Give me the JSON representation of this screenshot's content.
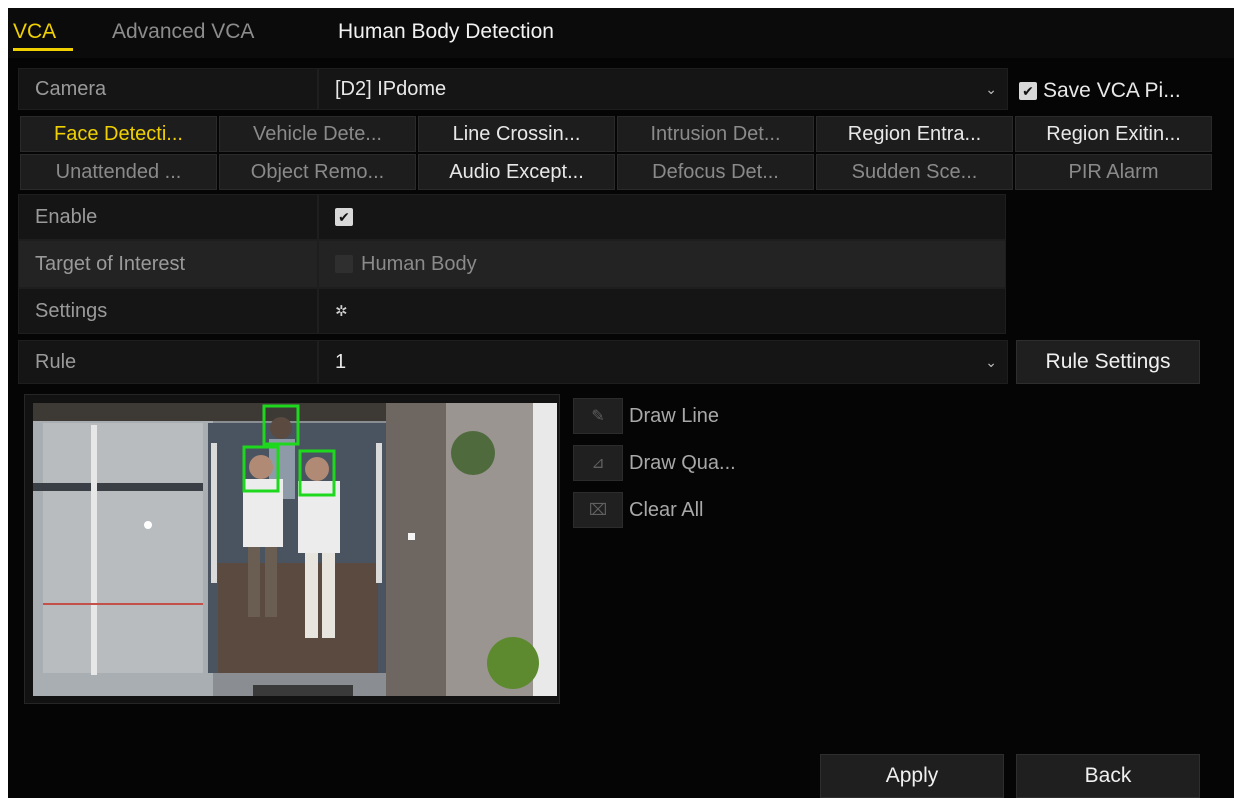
{
  "tabs": [
    {
      "label": "VCA"
    },
    {
      "label": "Advanced VCA"
    },
    {
      "label": "Human Body Detection"
    }
  ],
  "camera": {
    "label": "Camera",
    "value": "[D2] IPdome",
    "save_label": "Save VCA Pi...",
    "save_checked": true
  },
  "functions": {
    "row1": [
      "Face Detecti...",
      "Vehicle Dete...",
      "Line Crossin...",
      "Intrusion Det...",
      "Region Entra...",
      "Region Exitin..."
    ],
    "row2": [
      "Unattended ...",
      "Object Remo...",
      "Audio Except...",
      "Defocus Det...",
      "Sudden Sce...",
      "PIR Alarm"
    ]
  },
  "settings": {
    "enable_label": "Enable",
    "enable_checked": true,
    "target_label": "Target of Interest",
    "target_value": "Human Body",
    "settings_label": "Settings"
  },
  "rule": {
    "label": "Rule",
    "value": "1",
    "button": "Rule Settings"
  },
  "tools": {
    "draw_line": "Draw Line",
    "draw_quad": "Draw Qua...",
    "clear_all": "Clear All"
  },
  "footer": {
    "apply": "Apply",
    "back": "Back"
  },
  "colors": {
    "accent": "#f0d000",
    "detection_box": "#1ed81e",
    "background": "#050505"
  },
  "icons": [
    "checkbox-icon",
    "chevron-down-icon",
    "gear-icon",
    "pencil-icon",
    "quad-draw-icon",
    "clear-icon"
  ]
}
